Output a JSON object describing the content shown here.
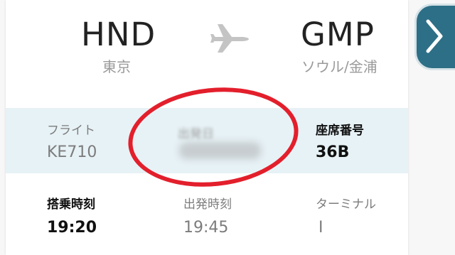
{
  "route": {
    "origin_code": "HND",
    "origin_city": "東京",
    "dest_code": "GMP",
    "dest_city": "ソウル/金浦"
  },
  "details": {
    "flight_label": "フライト",
    "flight_value": "KE710",
    "date_label": "出発日",
    "seat_label": "座席番号",
    "seat_value": "36B",
    "boarding_label": "搭乗時刻",
    "boarding_value": "19:20",
    "departure_label": "出発時刻",
    "departure_value": "19:45",
    "terminal_label": "ターミナル",
    "terminal_value": "I"
  },
  "icons": {
    "plane": "airplane-icon",
    "next": "chevron-right-icon"
  },
  "colors": {
    "accent": "#2d6f86",
    "highlight_row": "#e7f2f6",
    "annotation": "#e31f2c"
  }
}
